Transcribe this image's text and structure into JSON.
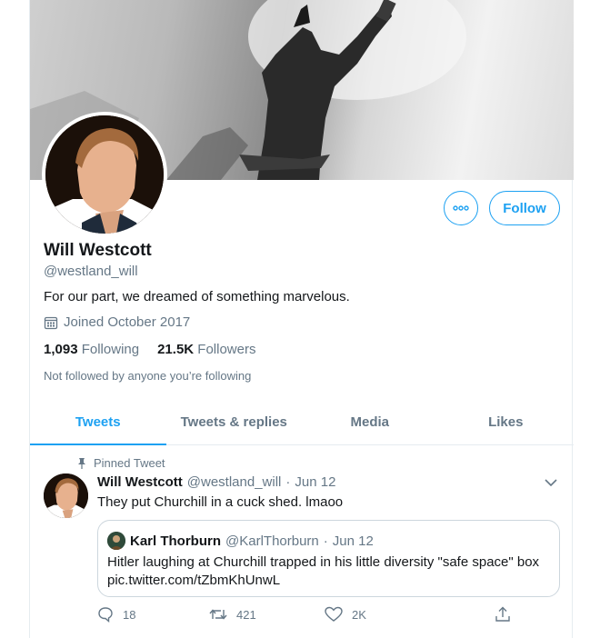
{
  "profile": {
    "display_name": "Will Westcott",
    "handle": "@westland_will",
    "bio": "For our part, we dreamed of something marvelous.",
    "joined": "Joined October 2017",
    "following_count": "1,093",
    "following_label": "Following",
    "followers_count": "21.5K",
    "followers_label": "Followers",
    "not_followed_text": "Not followed by anyone you’re following",
    "follow_label": "Follow",
    "more_icon": "more-dots-icon"
  },
  "tabs": [
    {
      "label": "Tweets",
      "active": true
    },
    {
      "label": "Tweets & replies",
      "active": false
    },
    {
      "label": "Media",
      "active": false
    },
    {
      "label": "Likes",
      "active": false
    }
  ],
  "tweet": {
    "pinned_label": "Pinned Tweet",
    "author_name": "Will Westcott",
    "author_handle": "@westland_will",
    "separator": "·",
    "date": "Jun 12",
    "text": "They put Churchill in a cuck shed. lmaoo",
    "quote": {
      "author_name": "Karl Thorburn",
      "author_handle": "@KarlThorburn",
      "date": "Jun 12",
      "text": "Hitler laughing at Churchill trapped in his little diversity \"safe space\" box pic.twitter.com/tZbmKhUnwL"
    },
    "actions": {
      "reply_count": "18",
      "retweet_count": "421",
      "like_count": "2K"
    }
  },
  "colors": {
    "accent": "#1da1f2",
    "text_primary": "#14171a",
    "text_secondary": "#657786",
    "border": "#e6ecf0"
  }
}
